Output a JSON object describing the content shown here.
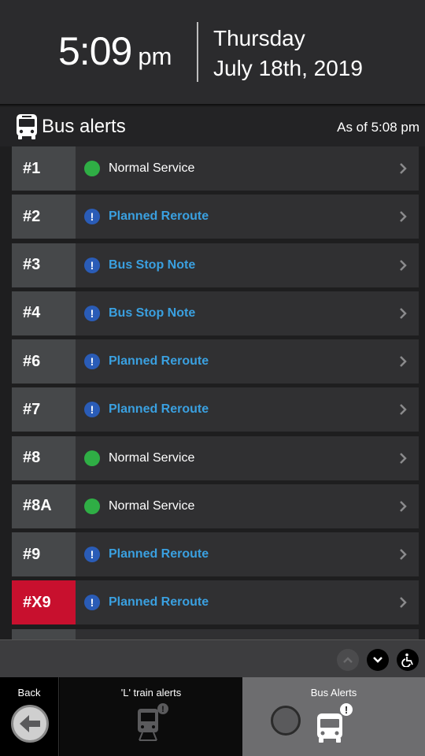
{
  "header": {
    "time": "5:09",
    "ampm": "pm",
    "weekday": "Thursday",
    "date": "July 18th, 2019"
  },
  "alerts": {
    "title": "Bus alerts",
    "as_of": "As of 5:08 pm",
    "icon": "bus-icon"
  },
  "routes": [
    {
      "route": "#1",
      "status": "Normal Service",
      "kind": "normal"
    },
    {
      "route": "#2",
      "status": "Planned Reroute",
      "kind": "alert"
    },
    {
      "route": "#3",
      "status": "Bus Stop Note",
      "kind": "alert"
    },
    {
      "route": "#4",
      "status": "Bus Stop Note",
      "kind": "alert"
    },
    {
      "route": "#6",
      "status": "Planned Reroute",
      "kind": "alert"
    },
    {
      "route": "#7",
      "status": "Planned Reroute",
      "kind": "alert"
    },
    {
      "route": "#8",
      "status": "Normal Service",
      "kind": "normal"
    },
    {
      "route": "#8A",
      "status": "Normal Service",
      "kind": "normal"
    },
    {
      "route": "#9",
      "status": "Planned Reroute",
      "kind": "alert"
    },
    {
      "route": "#X9",
      "status": "Planned Reroute",
      "kind": "alert",
      "express": true
    }
  ],
  "controls": {
    "up_icon": "chevron-up-icon",
    "down_icon": "chevron-down-icon",
    "accessibility_icon": "wheelchair-icon"
  },
  "nav": {
    "back": "Back",
    "train": "'L' train alerts",
    "bus": "Bus Alerts"
  },
  "colors": {
    "normal": "#2fae45",
    "alert_text": "#3aa0e0",
    "alert_icon": "#2a5cb7",
    "express": "#c8102e"
  }
}
